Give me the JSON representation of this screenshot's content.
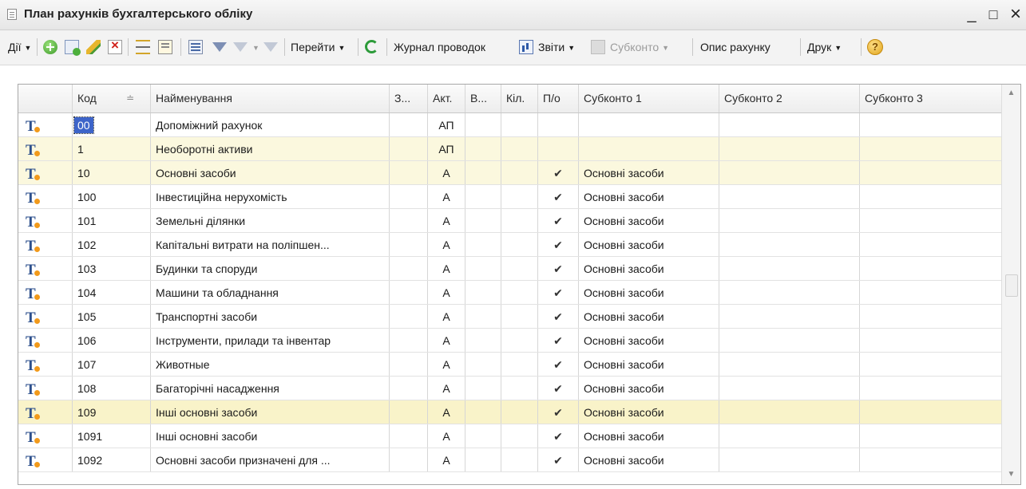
{
  "window": {
    "title": "План рахунків бухгалтерського обліку",
    "minimize": "_",
    "maximize": "□",
    "close": "×"
  },
  "toolbar": {
    "actions_label": "Дії",
    "goto_label": "Перейти",
    "journal_label": "Журнал проводок",
    "reports_label": "Звіти",
    "subconto_label": "Субконто",
    "description_label": "Опис рахунку",
    "print_label": "Друк",
    "help_label": "?"
  },
  "table": {
    "columns": [
      "Код",
      "Найменування",
      "З...",
      "Акт.",
      "В...",
      "Кіл.",
      "П/о",
      "Субконто 1",
      "Субконто 2",
      "Субконто 3"
    ],
    "sort_indicator": "≐",
    "rows": [
      {
        "code": "00",
        "name": "Допоміжний рахунок",
        "type": "АП",
        "po": "",
        "sub1": "",
        "group": false,
        "selected": true
      },
      {
        "code": "1",
        "name": "Необоротні активи",
        "type": "АП",
        "po": "",
        "sub1": "",
        "group": true,
        "selected": false
      },
      {
        "code": "10",
        "name": "Основні засоби",
        "type": "А",
        "po": "✔",
        "sub1": "Основні засоби",
        "group": true,
        "selected": false
      },
      {
        "code": "100",
        "name": "Інвестиційна нерухомість",
        "type": "А",
        "po": "✔",
        "sub1": "Основні засоби",
        "group": false,
        "selected": false
      },
      {
        "code": "101",
        "name": "Земельні ділянки",
        "type": "А",
        "po": "✔",
        "sub1": "Основні засоби",
        "group": false,
        "selected": false
      },
      {
        "code": "102",
        "name": "Капітальні витрати на поліпшен...",
        "type": "А",
        "po": "✔",
        "sub1": "Основні засоби",
        "group": false,
        "selected": false
      },
      {
        "code": "103",
        "name": "Будинки та споруди",
        "type": "А",
        "po": "✔",
        "sub1": "Основні засоби",
        "group": false,
        "selected": false
      },
      {
        "code": "104",
        "name": "Машини та обладнання",
        "type": "А",
        "po": "✔",
        "sub1": "Основні засоби",
        "group": false,
        "selected": false
      },
      {
        "code": "105",
        "name": "Транспортні засоби",
        "type": "А",
        "po": "✔",
        "sub1": "Основні засоби",
        "group": false,
        "selected": false
      },
      {
        "code": "106",
        "name": "Інструменти, прилади та інвентар",
        "type": "А",
        "po": "✔",
        "sub1": "Основні засоби",
        "group": false,
        "selected": false
      },
      {
        "code": "107",
        "name": "Животные",
        "type": "А",
        "po": "✔",
        "sub1": "Основні засоби",
        "group": false,
        "selected": false
      },
      {
        "code": "108",
        "name": "Багаторічні насадження",
        "type": "А",
        "po": "✔",
        "sub1": "Основні засоби",
        "group": false,
        "selected": false
      },
      {
        "code": "109",
        "name": "Інші основні засоби",
        "type": "А",
        "po": "✔",
        "sub1": "Основні засоби",
        "group": true,
        "selected": false
      },
      {
        "code": "1091",
        "name": "Інші основні засоби",
        "type": "А",
        "po": "✔",
        "sub1": "Основні засоби",
        "group": false,
        "selected": false
      },
      {
        "code": "1092",
        "name": "Основні засоби призначені для ...",
        "type": "А",
        "po": "✔",
        "sub1": "Основні засоби",
        "group": false,
        "selected": false
      }
    ]
  },
  "scrollbar": {
    "up": "▲",
    "down": "▼"
  }
}
